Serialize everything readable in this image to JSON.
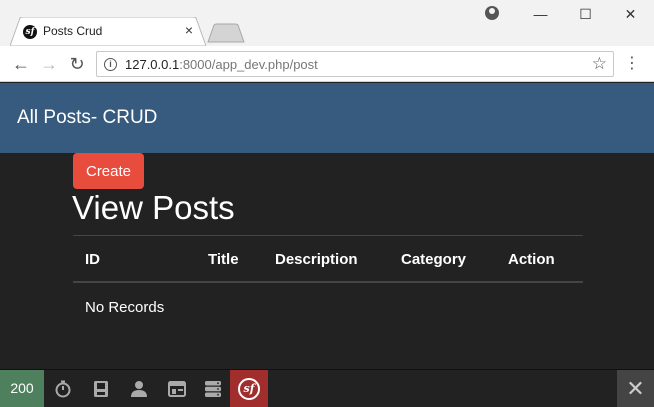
{
  "browser": {
    "tab_title": "Posts Crud",
    "tab_favicon": "sf",
    "tab_close": "×",
    "url_host": "127.0.0.1",
    "url_path": ":8000/app_dev.php/post",
    "window_controls": {
      "minimize": "—",
      "maximize": "☐",
      "close": "✕"
    }
  },
  "navbar": {
    "brand": "All Posts- CRUD",
    "color": "#375a7f"
  },
  "main": {
    "create_label": "Create",
    "heading": "View Posts",
    "table": {
      "columns": [
        "ID",
        "Title",
        "Description",
        "Category",
        "Action"
      ],
      "empty_message": "No Records"
    }
  },
  "debug_toolbar": {
    "status_code": "200",
    "icons": [
      "timer-icon",
      "memory-icon",
      "user-icon",
      "layout-icon",
      "database-icon"
    ],
    "logo": "sf",
    "close": "✕"
  },
  "colors": {
    "create_button": "#e74c3c",
    "status_ok": "#4f805d",
    "symfony_logo": "#a22d2d"
  }
}
